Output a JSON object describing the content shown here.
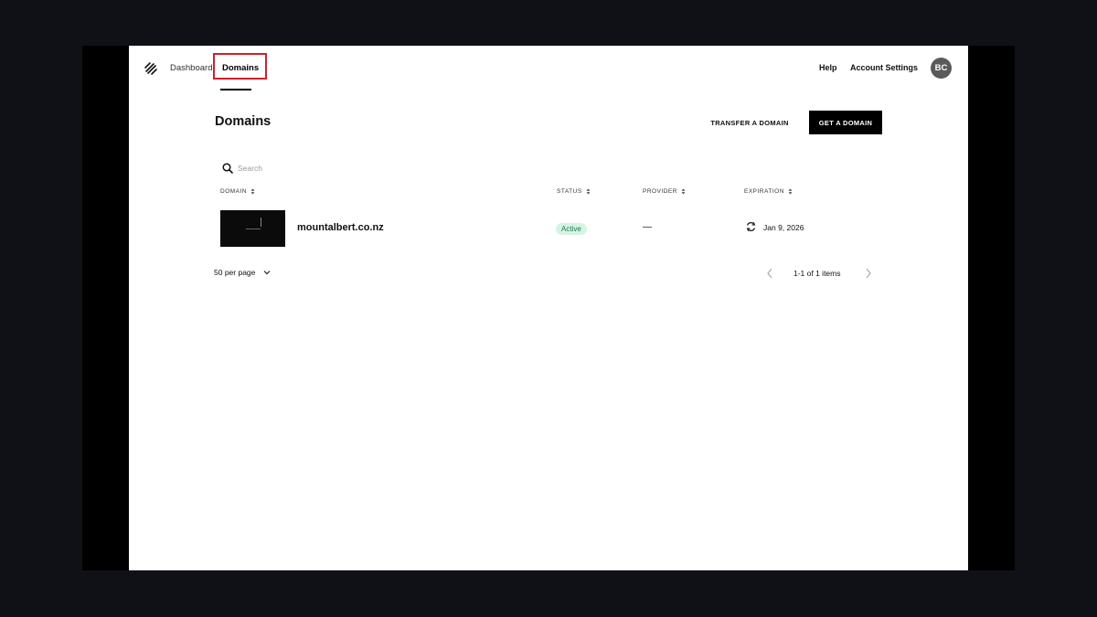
{
  "nav": {
    "dashboard": "Dashboard",
    "domains": "Domains",
    "help": "Help",
    "account_settings": "Account Settings",
    "avatar_initials": "BC"
  },
  "page": {
    "title": "Domains",
    "transfer_button": "TRANSFER A DOMAIN",
    "get_button": "GET A DOMAIN"
  },
  "search": {
    "placeholder": "Search"
  },
  "table": {
    "columns": [
      "DOMAIN",
      "STATUS",
      "PROVIDER",
      "EXPIRATION"
    ],
    "rows": [
      {
        "domain": "mountalbert.co.nz",
        "status": "Active",
        "provider": "—",
        "expiration": "Jan 9, 2026"
      }
    ]
  },
  "pagination": {
    "per_page": "50 per page",
    "info": "1-1 of 1 items"
  },
  "colors": {
    "highlight": "#d0202a",
    "active_badge_bg": "#d6f3e3",
    "active_badge_text": "#1d7a48"
  },
  "icons": [
    "squarespace-logo-icon",
    "search-icon",
    "sort-icon",
    "renew-icon",
    "chevron-down-icon",
    "chevron-left-icon",
    "chevron-right-icon"
  ]
}
